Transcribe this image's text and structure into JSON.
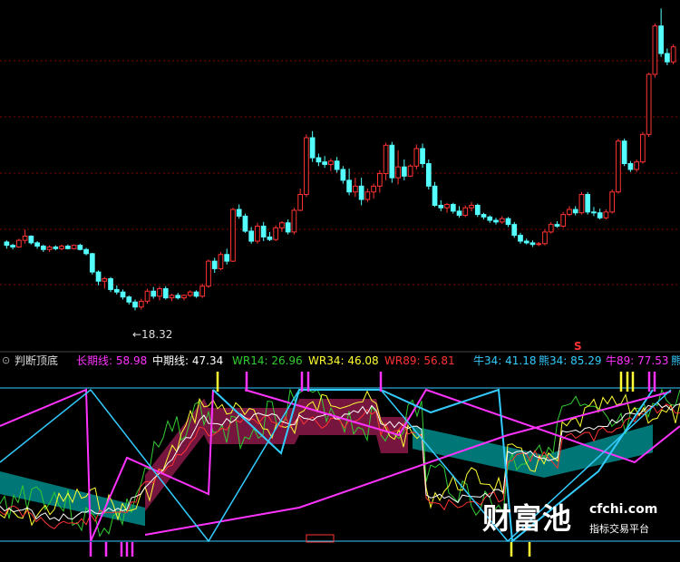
{
  "colors": {
    "bg": "#000000",
    "up": "#ff3333",
    "down": "#54ffff",
    "grid": "#8b0000",
    "axis": "#33ccff",
    "magenta": "#ff33ff",
    "cyan": "#33ccff",
    "yellow": "#ffff33",
    "green": "#33cc33",
    "white": "#ffffff",
    "red": "#ff3333",
    "teal": "#008b8b",
    "maroon": "#8b1a4a"
  },
  "main_chart": {
    "low_label": "←18.32",
    "signal_label": "S"
  },
  "indicator": {
    "title": "判断顶底",
    "items": [
      {
        "text": "长期线: 58.98",
        "color": "#ff33ff"
      },
      {
        "text": "中期线: 47.34",
        "color": "#ffffff"
      },
      {
        "text": "WR14: 26.96",
        "color": "#33cc33"
      },
      {
        "text": "WR34: 46.08",
        "color": "#ffff33"
      },
      {
        "text": "WR89: 56.81",
        "color": "#ff3333"
      },
      {
        "text": "牛34: 41.18",
        "color": "#33ccff"
      },
      {
        "text": "熊34: 85.29",
        "color": "#33ccff"
      },
      {
        "text": "牛89: 77.53",
        "color": "#ff33ff"
      },
      {
        "text": "熊",
        "color": "#33ccff"
      }
    ]
  },
  "watermark": {
    "brand": "财富池",
    "site": "cfchi.com",
    "tagline": "指标交易平台"
  },
  "chart_data": {
    "type": "candlestick",
    "title": "",
    "annotations": [
      "←18.32",
      "S"
    ],
    "candles": [
      [
        29.2,
        29.4,
        28.4,
        28.8
      ],
      [
        28.8,
        29.0,
        28.3,
        28.6
      ],
      [
        28.6,
        29.6,
        28.5,
        29.4
      ],
      [
        29.4,
        30.7,
        29.0,
        29.9
      ],
      [
        29.9,
        30.0,
        28.9,
        29.1
      ],
      [
        29.1,
        29.3,
        28.4,
        28.7
      ],
      [
        28.7,
        28.9,
        28.0,
        28.3
      ],
      [
        28.3,
        28.8,
        28.0,
        28.6
      ],
      [
        28.6,
        28.8,
        28.2,
        28.4
      ],
      [
        28.4,
        28.9,
        28.2,
        28.7
      ],
      [
        28.7,
        28.9,
        28.3,
        28.4
      ],
      [
        28.4,
        28.9,
        28.3,
        28.8
      ],
      [
        28.8,
        29.0,
        28.2,
        28.3
      ],
      [
        28.3,
        28.5,
        27.6,
        27.8
      ],
      [
        27.8,
        27.9,
        25.3,
        25.6
      ],
      [
        25.6,
        25.8,
        24.0,
        24.5
      ],
      [
        24.5,
        25.0,
        23.6,
        24.8
      ],
      [
        24.8,
        25.0,
        23.2,
        23.5
      ],
      [
        23.5,
        24.0,
        22.9,
        23.2
      ],
      [
        23.2,
        23.5,
        22.3,
        22.6
      ],
      [
        22.6,
        22.8,
        21.7,
        22.0
      ],
      [
        22.0,
        22.3,
        21.0,
        21.4
      ],
      [
        21.4,
        22.4,
        21.1,
        22.1
      ],
      [
        22.1,
        23.6,
        21.8,
        23.3
      ],
      [
        23.3,
        23.8,
        22.4,
        22.7
      ],
      [
        22.7,
        23.9,
        22.2,
        23.6
      ],
      [
        23.6,
        23.9,
        22.3,
        22.5
      ],
      [
        22.5,
        23.0,
        22.1,
        22.8
      ],
      [
        22.8,
        23.1,
        22.3,
        22.5
      ],
      [
        22.5,
        22.9,
        22.2,
        22.8
      ],
      [
        22.8,
        23.4,
        22.6,
        23.2
      ],
      [
        23.2,
        23.4,
        22.5,
        22.7
      ],
      [
        22.7,
        24.2,
        22.5,
        23.9
      ],
      [
        23.9,
        27.1,
        23.7,
        26.9
      ],
      [
        26.9,
        27.3,
        25.5,
        26.0
      ],
      [
        26.0,
        28.0,
        25.8,
        27.7
      ],
      [
        27.7,
        28.4,
        26.5,
        26.9
      ],
      [
        26.9,
        33.3,
        26.8,
        33.1
      ],
      [
        33.1,
        33.7,
        32.0,
        32.3
      ],
      [
        32.3,
        32.6,
        30.3,
        30.5
      ],
      [
        30.5,
        31.0,
        29.0,
        29.3
      ],
      [
        29.3,
        31.5,
        29.0,
        31.1
      ],
      [
        31.1,
        31.6,
        29.3,
        29.8
      ],
      [
        29.8,
        30.4,
        29.3,
        29.5
      ],
      [
        29.5,
        31.2,
        29.3,
        30.9
      ],
      [
        30.9,
        31.7,
        30.4,
        31.5
      ],
      [
        31.5,
        31.9,
        30.1,
        30.4
      ],
      [
        30.4,
        33.3,
        30.1,
        33.0
      ],
      [
        33.0,
        35.6,
        32.9,
        34.9
      ],
      [
        34.9,
        42.1,
        34.6,
        41.7
      ],
      [
        41.7,
        42.5,
        38.8,
        39.3
      ],
      [
        39.3,
        39.8,
        38.3,
        38.8
      ],
      [
        38.8,
        39.5,
        38.1,
        38.5
      ],
      [
        38.5,
        39.2,
        37.7,
        38.9
      ],
      [
        38.9,
        39.4,
        37.5,
        37.9
      ],
      [
        37.9,
        38.3,
        36.2,
        36.6
      ],
      [
        36.6,
        38.0,
        34.8,
        35.2
      ],
      [
        35.2,
        36.9,
        34.6,
        35.9
      ],
      [
        35.9,
        36.9,
        33.6,
        34.3
      ],
      [
        34.3,
        35.6,
        34.0,
        35.2
      ],
      [
        35.2,
        36.2,
        34.4,
        35.9
      ],
      [
        35.9,
        37.8,
        35.1,
        37.4
      ],
      [
        37.4,
        41.1,
        36.6,
        40.8
      ],
      [
        40.8,
        41.2,
        36.3,
        36.9
      ],
      [
        36.9,
        40.2,
        36.1,
        38.2
      ],
      [
        38.2,
        39.1,
        36.6,
        37.1
      ],
      [
        37.1,
        38.5,
        37.0,
        38.3
      ],
      [
        38.3,
        40.9,
        37.9,
        40.4
      ],
      [
        40.4,
        41.0,
        38.1,
        38.6
      ],
      [
        38.6,
        39.1,
        35.5,
        35.9
      ],
      [
        35.9,
        36.4,
        33.4,
        33.6
      ],
      [
        33.6,
        34.2,
        32.9,
        33.3
      ],
      [
        33.3,
        33.9,
        32.7,
        33.7
      ],
      [
        33.7,
        33.9,
        32.6,
        32.9
      ],
      [
        32.9,
        33.5,
        32.1,
        32.4
      ],
      [
        32.4,
        33.6,
        32.2,
        33.3
      ],
      [
        33.3,
        34.0,
        32.9,
        33.6
      ],
      [
        33.6,
        33.8,
        32.2,
        32.5
      ],
      [
        32.5,
        32.7,
        31.9,
        32.2
      ],
      [
        32.2,
        32.4,
        31.5,
        31.8
      ],
      [
        31.8,
        32.1,
        31.3,
        31.6
      ],
      [
        31.6,
        32.3,
        31.4,
        32.0
      ],
      [
        32.0,
        32.2,
        31.0,
        31.3
      ],
      [
        31.3,
        31.6,
        29.7,
        30.0
      ],
      [
        30.0,
        30.3,
        29.0,
        29.3
      ],
      [
        29.3,
        29.6,
        28.9,
        29.1
      ],
      [
        29.1,
        29.4,
        28.6,
        28.9
      ],
      [
        28.9,
        29.2,
        28.7,
        29.0
      ],
      [
        29.0,
        30.7,
        28.8,
        30.4
      ],
      [
        30.4,
        31.6,
        30.2,
        31.3
      ],
      [
        31.3,
        31.7,
        30.9,
        31.1
      ],
      [
        31.1,
        32.8,
        30.9,
        32.5
      ],
      [
        32.5,
        33.5,
        32.3,
        33.1
      ],
      [
        33.1,
        33.5,
        32.4,
        32.7
      ],
      [
        32.7,
        35.2,
        32.5,
        34.9
      ],
      [
        34.9,
        35.2,
        32.5,
        32.8
      ],
      [
        32.8,
        33.4,
        32.3,
        32.7
      ],
      [
        32.7,
        33.2,
        31.9,
        32.1
      ],
      [
        32.1,
        33.1,
        31.9,
        32.8
      ],
      [
        32.8,
        35.5,
        32.6,
        35.2
      ],
      [
        35.2,
        41.6,
        35.0,
        41.3
      ],
      [
        41.3,
        41.6,
        38.3,
        38.6
      ],
      [
        38.6,
        38.9,
        37.6,
        37.9
      ],
      [
        37.9,
        39.1,
        37.6,
        38.8
      ],
      [
        38.8,
        42.4,
        38.6,
        42.1
      ],
      [
        42.1,
        49.5,
        41.8,
        49.3
      ],
      [
        49.3,
        55.4,
        48.9,
        55.1
      ],
      [
        55.1,
        57.2,
        51.4,
        51.8
      ],
      [
        51.8,
        52.4,
        50.4,
        50.8
      ],
      [
        50.8,
        52.9,
        50.5,
        52.6
      ]
    ],
    "indicator_series": [
      {
        "name": "长期线",
        "color": "#ff33ff",
        "last": 58.98
      },
      {
        "name": "中期线",
        "color": "#ffffff",
        "last": 47.34
      },
      {
        "name": "WR14",
        "color": "#33cc33",
        "last": 26.96
      },
      {
        "name": "WR34",
        "color": "#ffff33",
        "last": 46.08
      },
      {
        "name": "WR89",
        "color": "#ff3333",
        "last": 56.81
      },
      {
        "name": "牛34",
        "color": "#33ccff",
        "last": 41.18
      },
      {
        "name": "熊34",
        "color": "#33ccff",
        "last": 85.29
      },
      {
        "name": "牛89",
        "color": "#ff33ff",
        "last": 77.53
      }
    ]
  }
}
